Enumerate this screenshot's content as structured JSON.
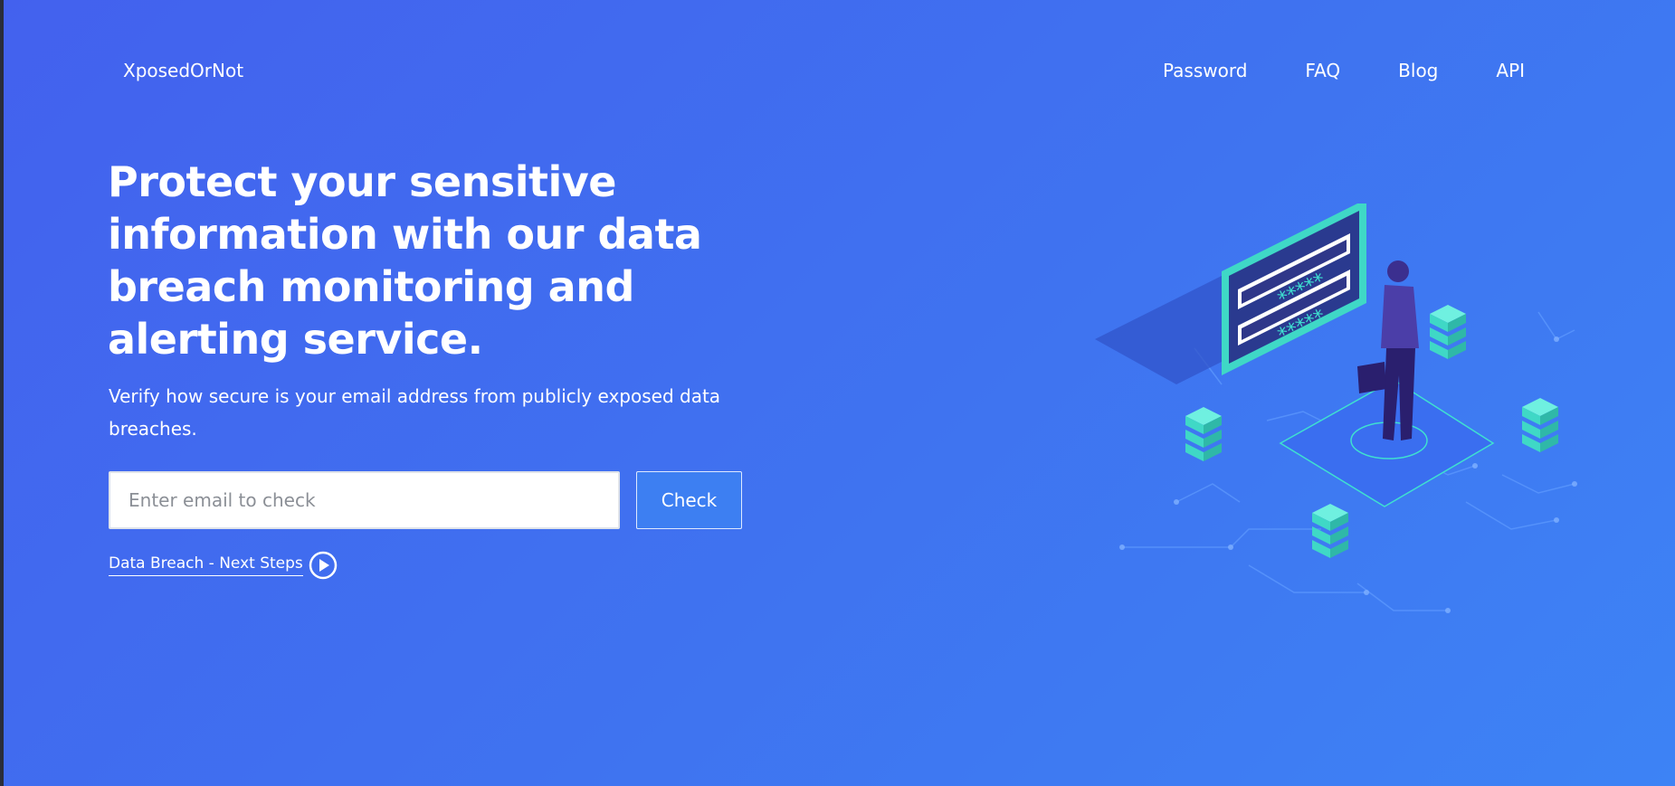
{
  "header": {
    "brand": "XposedOrNot",
    "nav": [
      {
        "label": "Password"
      },
      {
        "label": "FAQ"
      },
      {
        "label": "Blog"
      },
      {
        "label": "API"
      }
    ]
  },
  "hero": {
    "headline": "Protect your sensitive information with our data breach monitoring and alerting service.",
    "subtext": "Verify how secure is your email address from publicly exposed data breaches.",
    "email_placeholder": "Enter email to check",
    "email_value": "",
    "check_label": "Check",
    "next_steps_label": "Data Breach - Next Steps",
    "next_steps_icon": "play-circle-icon"
  },
  "illustration": {
    "icon": "security-isometric-illustration",
    "password_mask_1": "*****",
    "password_mask_2": "*****"
  },
  "colors": {
    "background_start": "#4361ee",
    "background_end": "#3d83f5",
    "accent_teal": "#3fe0d0",
    "button_blue": "#3d7ff2"
  }
}
